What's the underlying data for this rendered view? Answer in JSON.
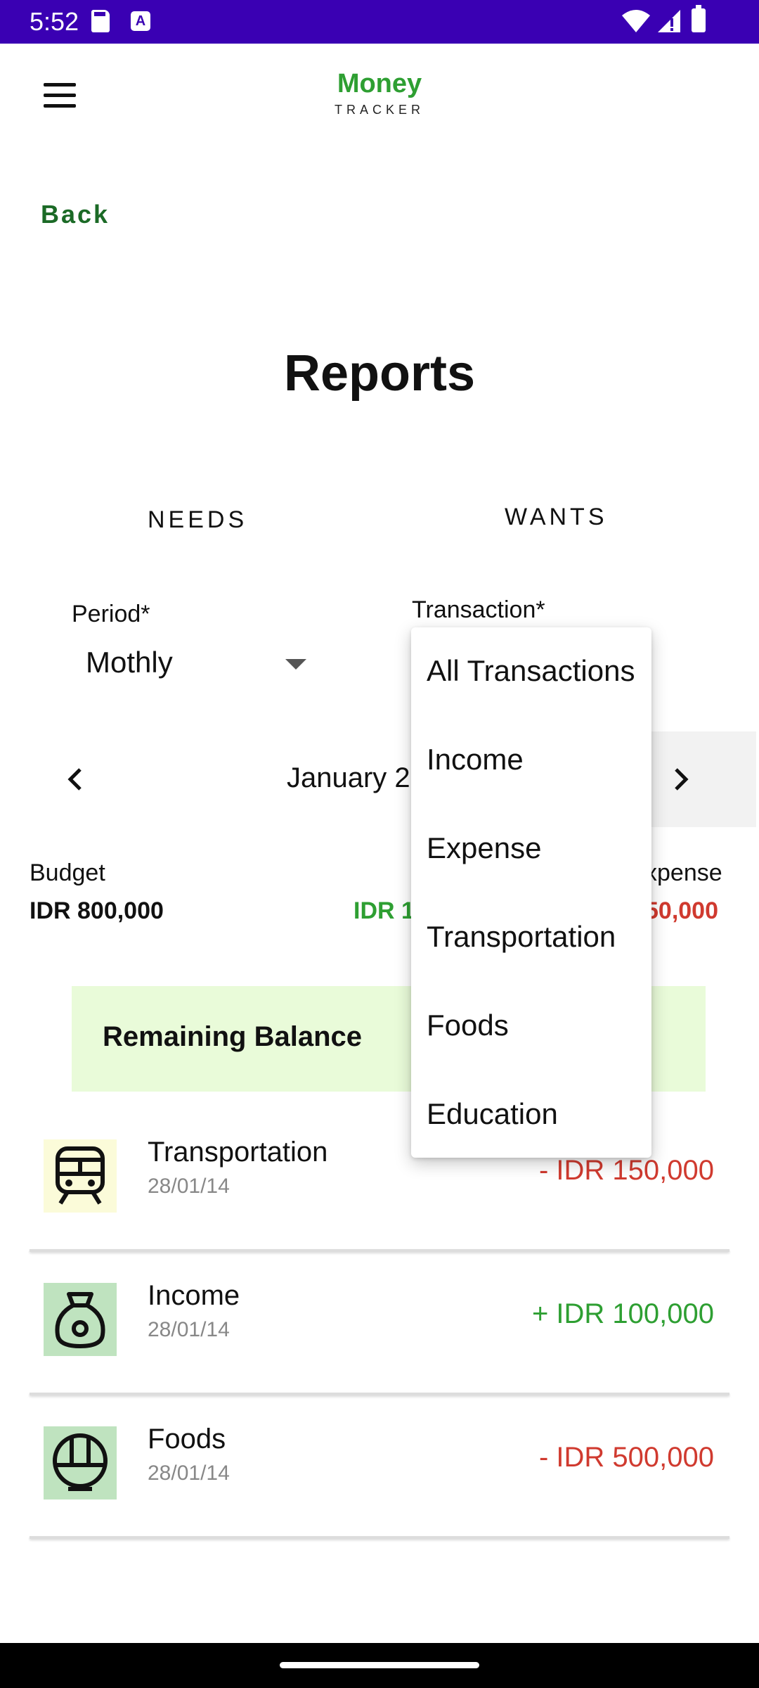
{
  "status_bar": {
    "time": "5:52",
    "a_icon": "A"
  },
  "app_bar": {
    "logo_line1": "Money",
    "logo_line2": "TRACKER"
  },
  "back_label": "Back",
  "page_title": "Reports",
  "tabs": [
    {
      "label": "NEEDS"
    },
    {
      "label": "WANTS"
    }
  ],
  "filters": {
    "period_label": "Period*",
    "period_value": "Mothly",
    "transaction_label": "Transaction*"
  },
  "month_nav": {
    "label": "January 2"
  },
  "summary": {
    "budget_label": "Budget",
    "budget_value": "IDR 800,000",
    "income_value_partial": "IDR 1",
    "expense_label_partial": "xpense",
    "expense_value_partial": "50,000"
  },
  "remaining_balance_label": "Remaining Balance",
  "transactions": [
    {
      "name": "Transportation",
      "date": "28/01/14",
      "amount": "- IDR 150,000",
      "icon": "train-icon",
      "icon_bg": "#fbfbd9"
    },
    {
      "name": "Income",
      "date": "28/01/14",
      "amount": "+ IDR 100,000",
      "icon": "money-bag-icon",
      "icon_bg": "#bfe3bf"
    },
    {
      "name": "Foods",
      "date": "28/01/14",
      "amount": "- IDR 500,000",
      "icon": "food-bowl-icon",
      "icon_bg": "#bfe3bf"
    }
  ],
  "dropdown_options": [
    "All Transactions",
    "Income",
    "Expense",
    "Transportation",
    "Foods",
    "Education"
  ],
  "colors": {
    "status_bar": "#3a00b3",
    "brand_green": "#2e9f32",
    "back_green": "#1b6a26",
    "expense_red": "#d03a2f",
    "remaining_bg": "#e9fbd9"
  }
}
